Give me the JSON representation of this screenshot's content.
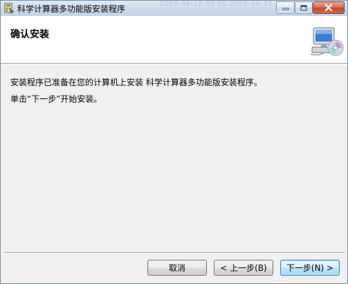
{
  "window": {
    "title": "科学计算器多功能版安装程序",
    "background_text": "2009-06-18 00:00   2009-06-18 00:00   LNK 1"
  },
  "header": {
    "title": "确认安装",
    "icon": "computer-with-disc-icon"
  },
  "body": {
    "line1": "安装程序已准备在您的计算机上安装 科学计算器多功能版安装程序。",
    "line2": "单击“下一步”开始安装。"
  },
  "buttons": {
    "cancel_label": "取消",
    "back_label": "< 上一步(B)",
    "next_label": "下一步(N) >"
  },
  "colors": {
    "titlebar": "#cfdced",
    "close_button": "#c14a2e",
    "default_button_border": "#3c7fb1"
  }
}
